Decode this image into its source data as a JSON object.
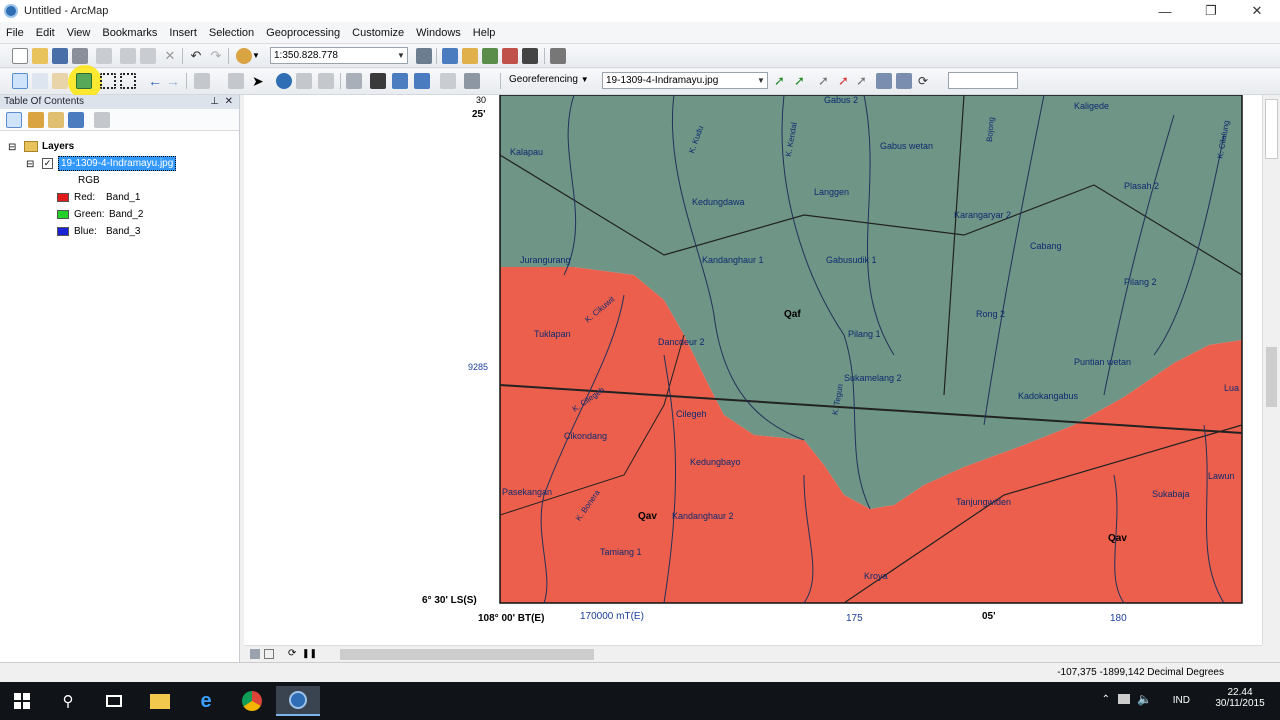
{
  "window": {
    "title": "Untitled - ArcMap"
  },
  "menu": [
    "File",
    "Edit",
    "View",
    "Bookmarks",
    "Insert",
    "Selection",
    "Geoprocessing",
    "Customize",
    "Windows",
    "Help"
  ],
  "toolbar": {
    "scale": "1:350.828.778",
    "georef_label": "Georeferencing",
    "layer_select": "19-1309-4-Indramayu.jpg",
    "georef_input": ""
  },
  "toc": {
    "title": "Table Of Contents",
    "layers_label": "Layers",
    "layer_name": "19-1309-4-Indramayu.jpg",
    "rgb_label": "RGB",
    "bands": [
      {
        "label": "Red:",
        "band": "Band_1",
        "color": "#e0191a"
      },
      {
        "label": "Green:",
        "band": "Band_2",
        "color": "#22d028"
      },
      {
        "label": "Blue:",
        "band": "Band_3",
        "color": "#1a22d4"
      }
    ]
  },
  "map": {
    "coord_25": "25'",
    "coord_30": "30",
    "coord_9285": "9285",
    "coord_lat": "6° 30' LS(S)",
    "coord_lon": "108° 00' BT(E)",
    "coord_170000": "170000 mT(E)",
    "coord_175": "175",
    "coord_05": "05'",
    "coord_180": "180",
    "unit_qaf": "Qaf",
    "unit_qav1": "Qav",
    "unit_qav2": "Qav",
    "places": [
      "Kalapau",
      "Kedungdawa",
      "Langgen",
      "Gabus wetan",
      "Karangaryar 2",
      "Plasah 2",
      "Jurangurang",
      "Kandanghaur 1",
      "Gabusudik 1",
      "Cabang",
      "Pilang 2",
      "Kaligede",
      "Tuklapan",
      "Dancdeur 2",
      "Pilang 1",
      "Rong 2",
      "Sukamelang 2",
      "Puntian wetan",
      "Cikondang",
      "Cilegeh",
      "Kadokangabus",
      "Kedungbayo",
      "Pasekangan",
      "Kandanghaur 2",
      "Sukabaja",
      "Tamiang 1",
      "Kroya",
      "Tanjungwiden",
      "Lawun",
      "Lua",
      "Gabus 2"
    ],
    "rivers": [
      "K. Kudu",
      "K. Kendal",
      "K. Tegun",
      "K. Cikuwit",
      "K. Cilegeh",
      "K. Bonera",
      "Bojong",
      "K. Cilalung"
    ]
  },
  "status": {
    "coords": "-107,375  -1899,142 Decimal Degrees"
  },
  "taskbar": {
    "lang": "IND",
    "time": "22.44",
    "date": "30/11/2015"
  },
  "colors": {
    "red_unit": "#ec5f4c",
    "green_unit": "#6e9585",
    "highlight": "#3399ff"
  }
}
